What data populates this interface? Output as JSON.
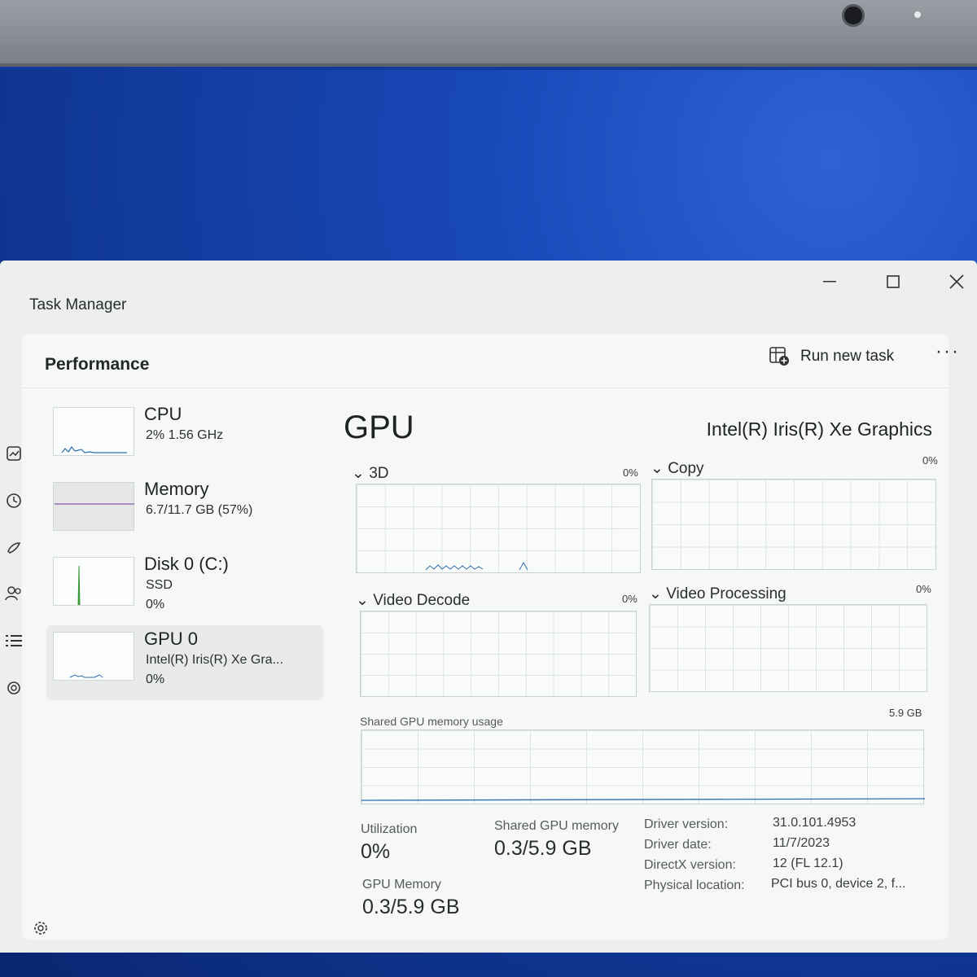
{
  "window": {
    "title": "Task Manager",
    "controls": [
      "minimize",
      "maximize",
      "close"
    ]
  },
  "header": {
    "page_title": "Performance",
    "run_new_task_label": "Run new task",
    "more_label": "···"
  },
  "nav_icons": [
    "processes-icon",
    "app-history-icon",
    "startup-apps-icon",
    "users-icon",
    "details-icon",
    "services-icon"
  ],
  "devices": [
    {
      "name": "CPU",
      "line1": "2%  1.56 GHz",
      "line2": ""
    },
    {
      "name": "Memory",
      "line1": "6.7/11.7 GB (57%)",
      "line2": ""
    },
    {
      "name": "Disk 0 (C:)",
      "line1": "SSD",
      "line2": "0%"
    },
    {
      "name": "GPU 0",
      "line1": "Intel(R) Iris(R) Xe Gra...",
      "line2": "0%"
    }
  ],
  "gpu": {
    "title": "GPU",
    "model": "Intel(R) Iris(R) Xe Graphics",
    "graphs": [
      {
        "label": "3D",
        "pct": "0%"
      },
      {
        "label": "Copy",
        "pct": "0%"
      },
      {
        "label": "Video Decode",
        "pct": "0%"
      },
      {
        "label": "Video Processing",
        "pct": "0%"
      }
    ],
    "shared_memory_graph": {
      "label": "Shared GPU memory usage",
      "max": "5.9 GB"
    },
    "stats": {
      "utilization_label": "Utilization",
      "utilization_value": "0%",
      "shared_label": "Shared GPU memory",
      "shared_value": "0.3/5.9 GB",
      "gpu_memory_label": "GPU Memory",
      "gpu_memory_value": "0.3/5.9 GB"
    },
    "info": [
      {
        "label": "Driver version:",
        "value": "31.0.101.4953"
      },
      {
        "label": "Driver date:",
        "value": "11/7/2023"
      },
      {
        "label": "DirectX version:",
        "value": "12 (FL 12.1)"
      },
      {
        "label": "Physical location:",
        "value": "PCI bus 0, device 2, f..."
      }
    ]
  },
  "colors": {
    "window_bg": "#ecefee",
    "panel_bg": "#f6f8f7",
    "graph_grid": "#dde3e1",
    "cpu_line": "#2f6fb0",
    "disk_line": "#3a9a3a",
    "desktop_blue": "#1848b8"
  }
}
